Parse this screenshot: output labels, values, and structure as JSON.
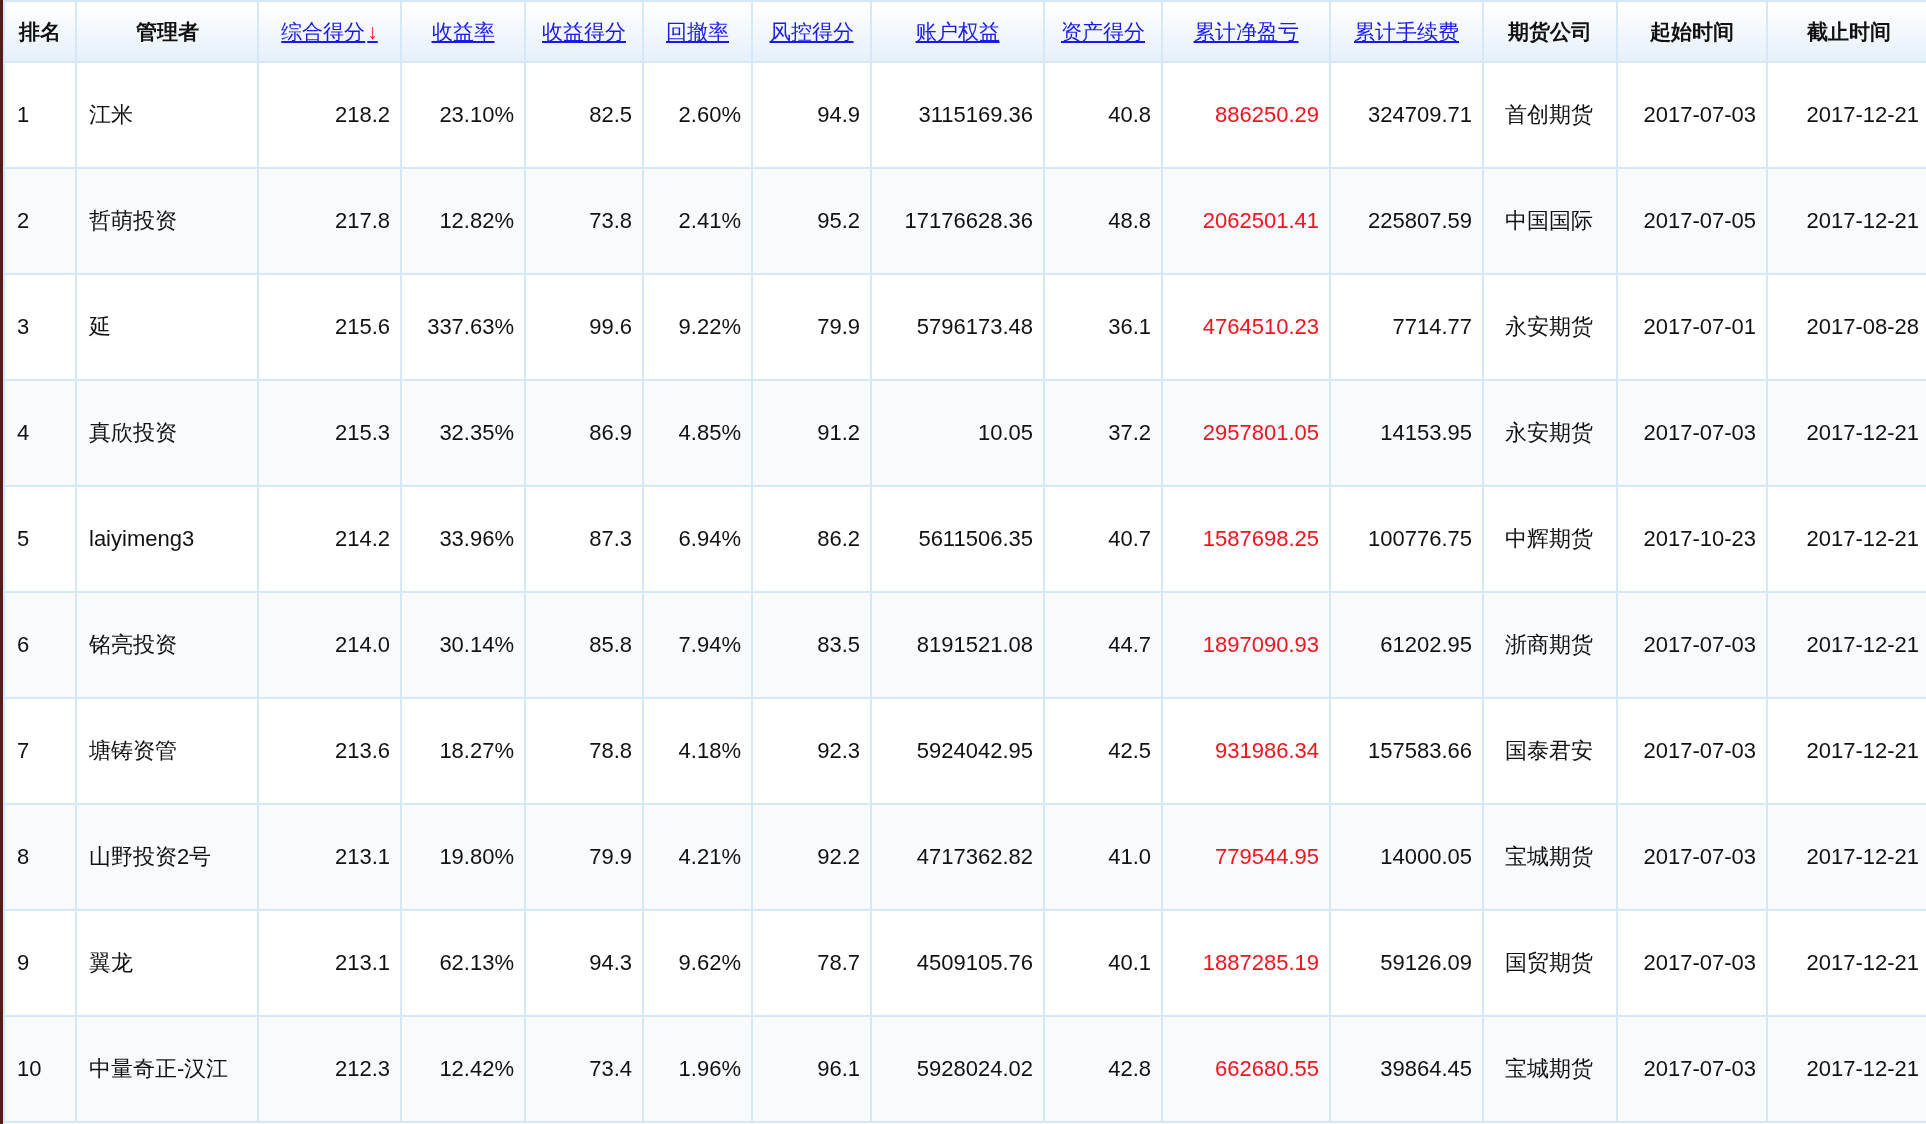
{
  "table": {
    "columns": [
      {
        "label": "排名",
        "kind": "text",
        "sortable": false
      },
      {
        "label": "管理者",
        "kind": "text",
        "sortable": false
      },
      {
        "label": "综合得分",
        "kind": "number",
        "sortable": true,
        "sort_arrow": "↓"
      },
      {
        "label": "收益率",
        "kind": "number",
        "sortable": true
      },
      {
        "label": "收益得分",
        "kind": "number",
        "sortable": true
      },
      {
        "label": "回撤率",
        "kind": "number",
        "sortable": true
      },
      {
        "label": "风控得分",
        "kind": "number",
        "sortable": true
      },
      {
        "label": "账户权益",
        "kind": "number",
        "sortable": true
      },
      {
        "label": "资产得分",
        "kind": "number",
        "sortable": true
      },
      {
        "label": "累计净盈亏",
        "kind": "money",
        "sortable": true
      },
      {
        "label": "累计手续费",
        "kind": "number",
        "sortable": true
      },
      {
        "label": "期货公司",
        "kind": "label",
        "sortable": false
      },
      {
        "label": "起始时间",
        "kind": "date",
        "sortable": false
      },
      {
        "label": "截止时间",
        "kind": "date",
        "sortable": false
      }
    ],
    "rows": [
      [
        "1",
        "江米",
        "218.2",
        "23.10%",
        "82.5",
        "2.60%",
        "94.9",
        "3115169.36",
        "40.8",
        "886250.29",
        "324709.71",
        "首创期货",
        "2017-07-03",
        "2017-12-21"
      ],
      [
        "2",
        "哲萌投资",
        "217.8",
        "12.82%",
        "73.8",
        "2.41%",
        "95.2",
        "17176628.36",
        "48.8",
        "2062501.41",
        "225807.59",
        "中国国际",
        "2017-07-05",
        "2017-12-21"
      ],
      [
        "3",
        "延",
        "215.6",
        "337.63%",
        "99.6",
        "9.22%",
        "79.9",
        "5796173.48",
        "36.1",
        "4764510.23",
        "7714.77",
        "永安期货",
        "2017-07-01",
        "2017-08-28"
      ],
      [
        "4",
        "真欣投资",
        "215.3",
        "32.35%",
        "86.9",
        "4.85%",
        "91.2",
        "10.05",
        "37.2",
        "2957801.05",
        "14153.95",
        "永安期货",
        "2017-07-03",
        "2017-12-21"
      ],
      [
        "5",
        "laiyimeng3",
        "214.2",
        "33.96%",
        "87.3",
        "6.94%",
        "86.2",
        "5611506.35",
        "40.7",
        "1587698.25",
        "100776.75",
        "中辉期货",
        "2017-10-23",
        "2017-12-21"
      ],
      [
        "6",
        "铭亮投资",
        "214.0",
        "30.14%",
        "85.8",
        "7.94%",
        "83.5",
        "8191521.08",
        "44.7",
        "1897090.93",
        "61202.95",
        "浙商期货",
        "2017-07-03",
        "2017-12-21"
      ],
      [
        "7",
        "塘铸资管",
        "213.6",
        "18.27%",
        "78.8",
        "4.18%",
        "92.3",
        "5924042.95",
        "42.5",
        "931986.34",
        "157583.66",
        "国泰君安",
        "2017-07-03",
        "2017-12-21"
      ],
      [
        "8",
        "山野投资2号",
        "213.1",
        "19.80%",
        "79.9",
        "4.21%",
        "92.2",
        "4717362.82",
        "41.0",
        "779544.95",
        "14000.05",
        "宝城期货",
        "2017-07-03",
        "2017-12-21"
      ],
      [
        "9",
        "翼龙",
        "213.1",
        "62.13%",
        "94.3",
        "9.62%",
        "78.7",
        "4509105.76",
        "40.1",
        "1887285.19",
        "59126.09",
        "国贸期货",
        "2017-07-03",
        "2017-12-21"
      ],
      [
        "10",
        "中量奇正-汉江",
        "212.3",
        "12.42%",
        "73.4",
        "1.96%",
        "96.1",
        "5928024.02",
        "42.8",
        "662680.55",
        "39864.45",
        "宝城期货",
        "2017-07-03",
        "2017-12-21"
      ]
    ]
  }
}
